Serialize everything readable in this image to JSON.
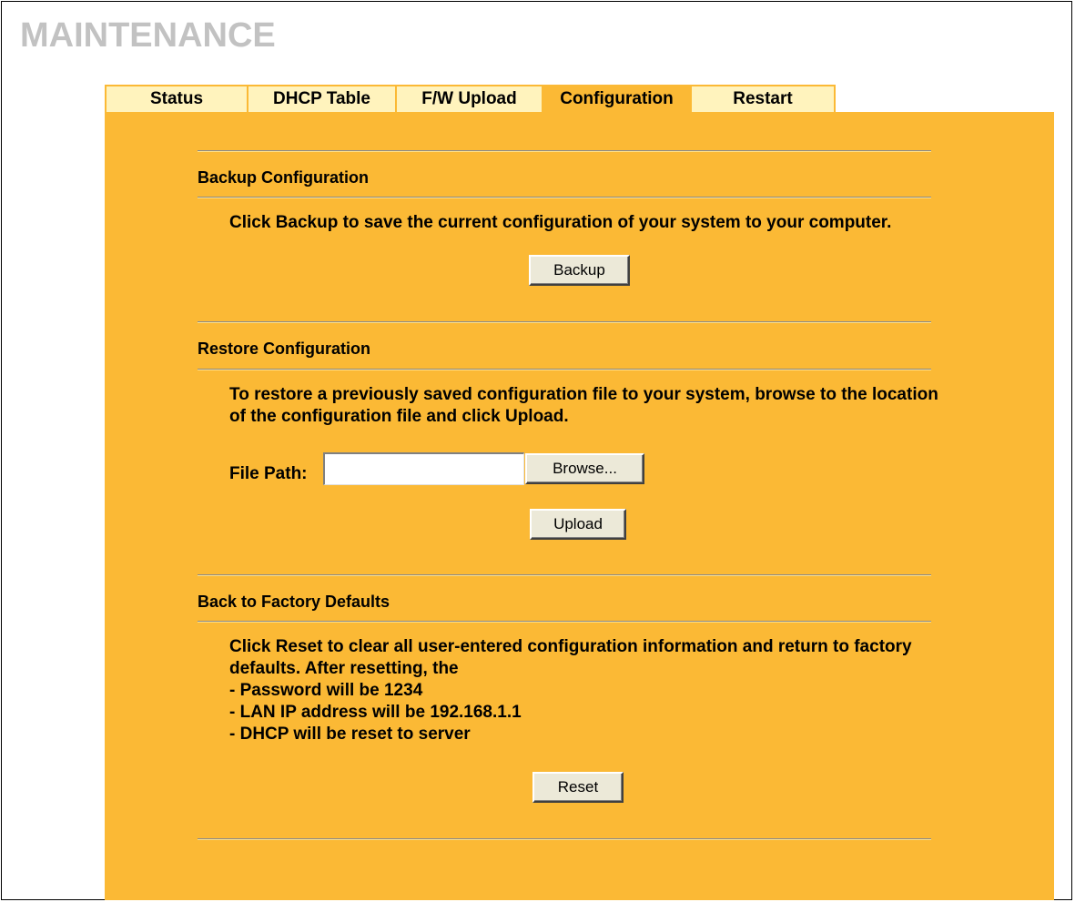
{
  "page": {
    "title": "MAINTENANCE"
  },
  "tabs": [
    {
      "label": "Status",
      "active": false
    },
    {
      "label": "DHCP Table",
      "active": false
    },
    {
      "label": "F/W Upload",
      "active": false
    },
    {
      "label": "Configuration",
      "active": true
    },
    {
      "label": "Restart",
      "active": false
    }
  ],
  "colors": {
    "panel": "#fbb935",
    "tab_inactive": "#fff3bd",
    "title": "#c2c2c2"
  },
  "backup": {
    "title": "Backup Configuration",
    "description": "Click Backup to save the current configuration of your system to your computer.",
    "button_label": "Backup"
  },
  "restore": {
    "title": "Restore Configuration",
    "description": "To restore a previously saved configuration file to your system, browse to the location of the configuration file and click Upload.",
    "file_path_label": "File Path:",
    "file_path_value": "",
    "browse_label": "Browse...",
    "upload_label": "Upload"
  },
  "factory": {
    "title": "Back to Factory Defaults",
    "description": "Click Reset to clear all user-entered configuration information and return to factory defaults. After resetting, the",
    "items": [
      "- Password will be 1234",
      "- LAN IP address will be 192.168.1.1",
      "- DHCP will be reset to server"
    ],
    "reset_label": "Reset"
  }
}
